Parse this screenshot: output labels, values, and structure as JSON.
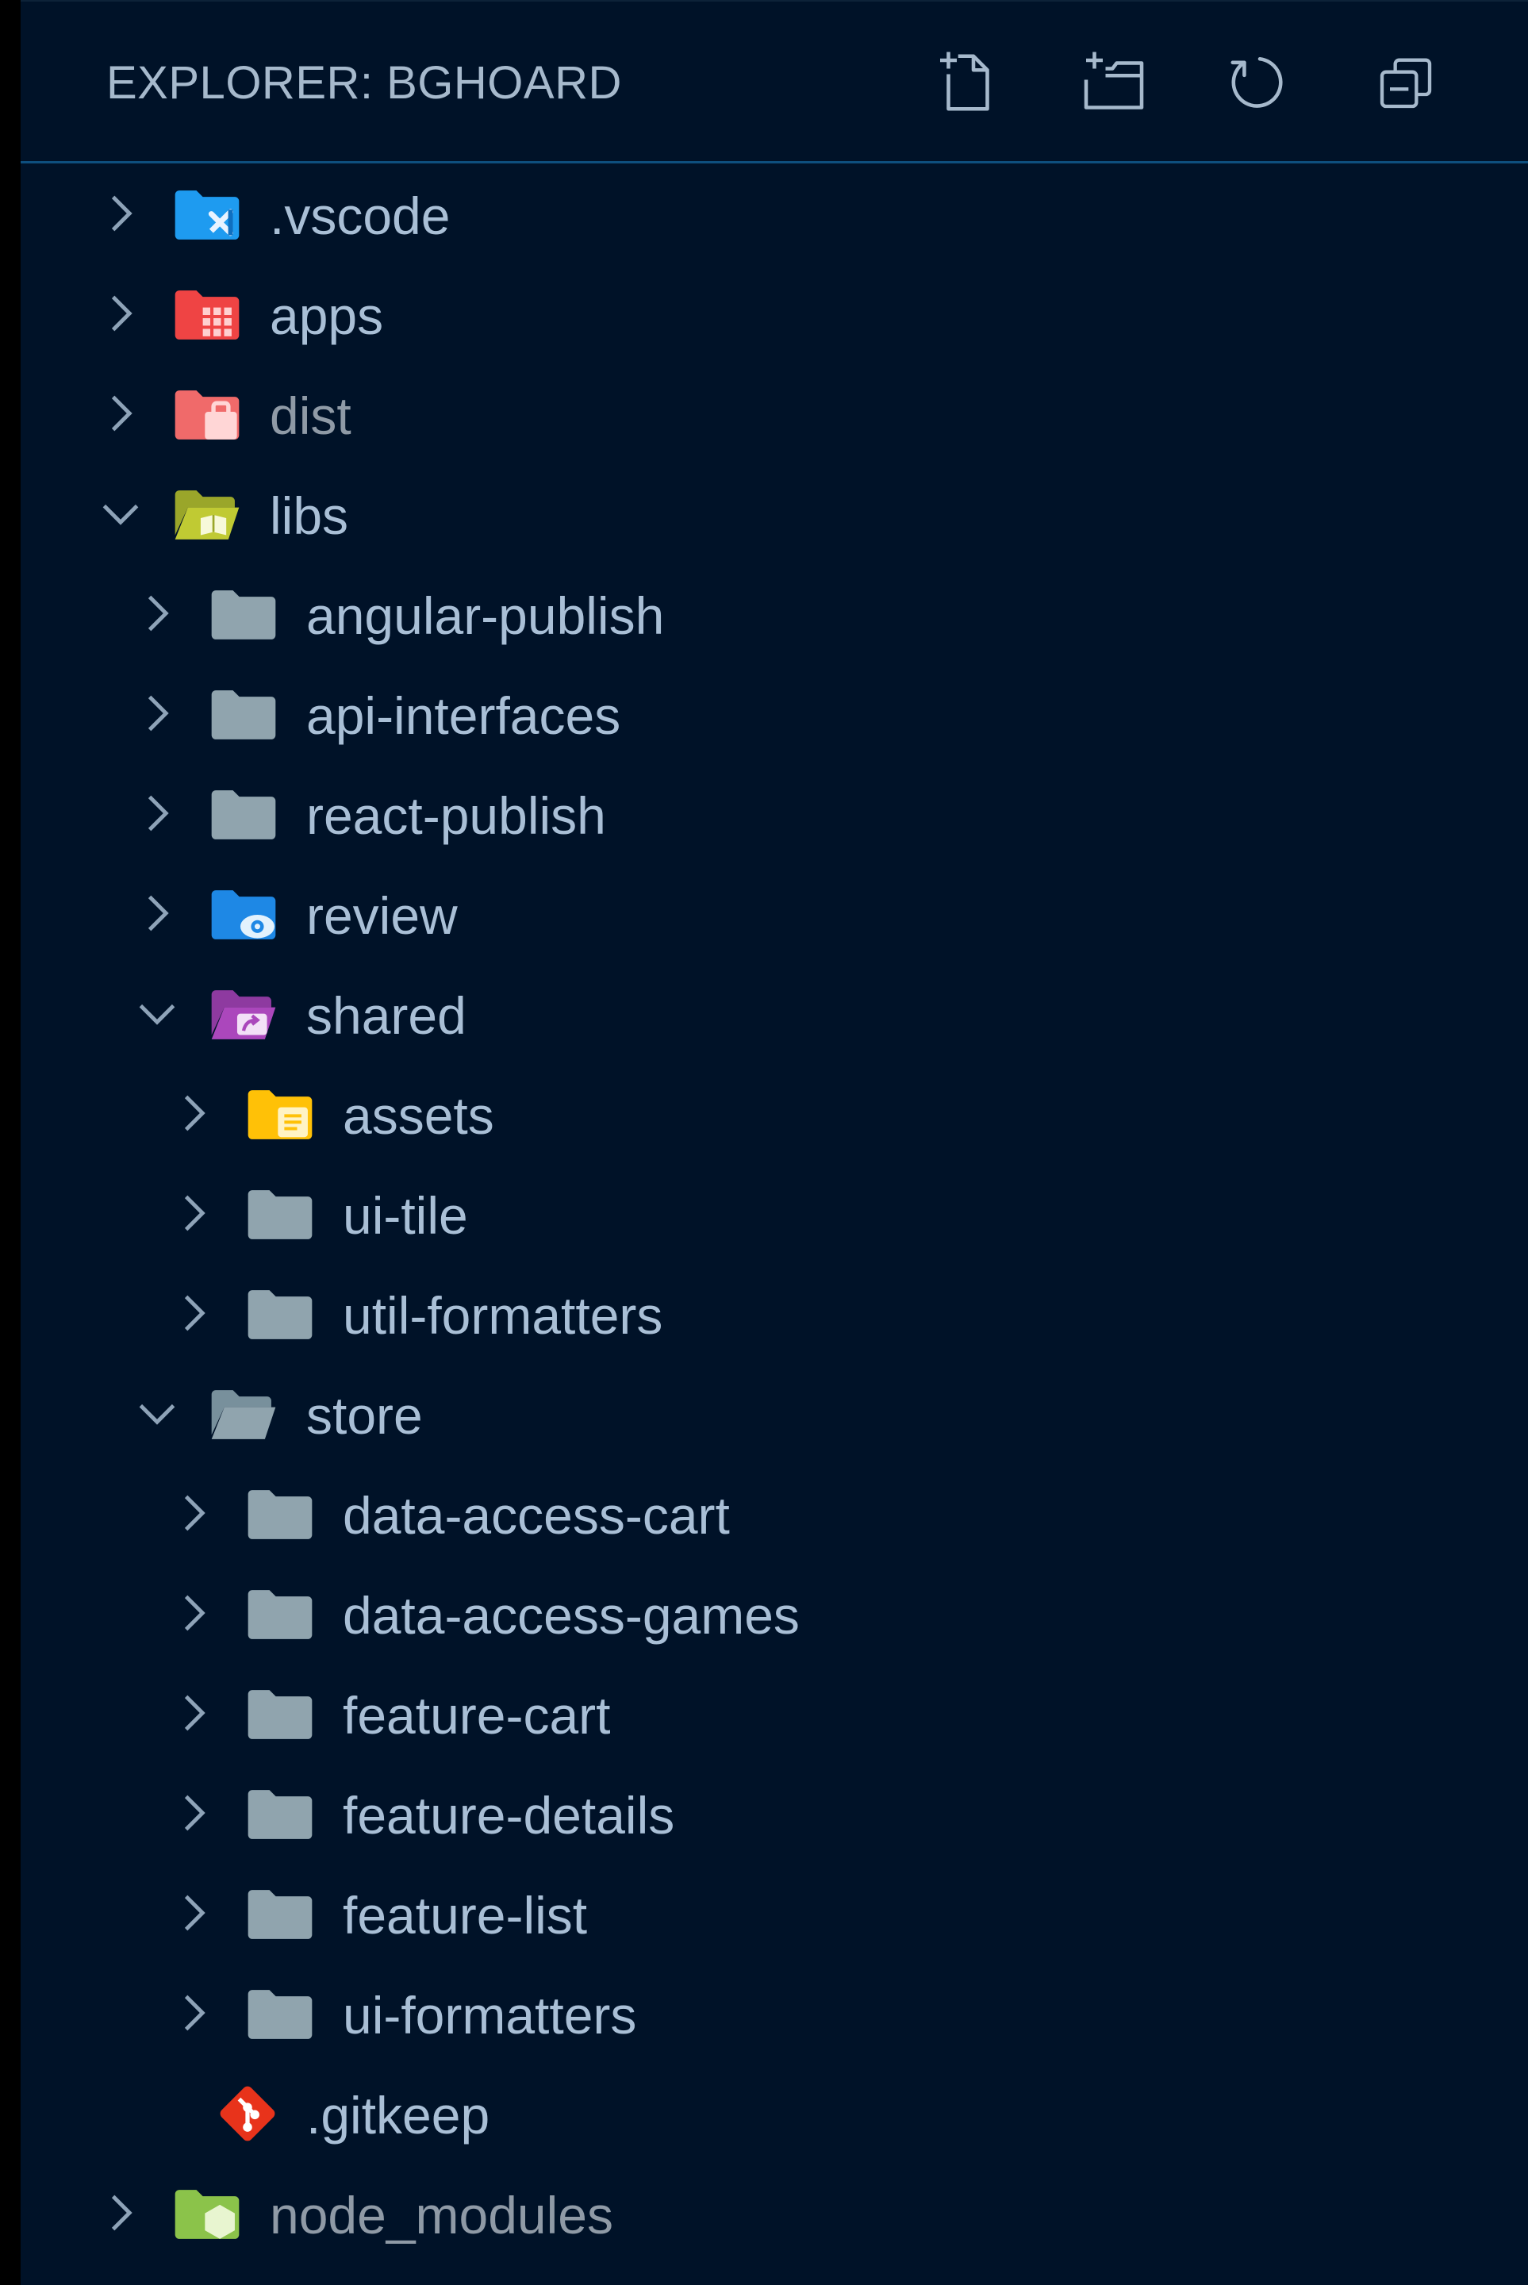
{
  "explorer": {
    "title": "EXPLORER: BGHOARD",
    "actions": [
      {
        "name": "new-file-button",
        "icon": "new-file-icon",
        "tooltip": "New File"
      },
      {
        "name": "new-folder-button",
        "icon": "new-folder-icon",
        "tooltip": "New Folder"
      },
      {
        "name": "refresh-button",
        "icon": "refresh-icon",
        "tooltip": "Refresh Explorer"
      },
      {
        "name": "collapse-all-button",
        "icon": "collapse-all-icon",
        "tooltip": "Collapse Folders in Explorer"
      }
    ]
  },
  "tree": {
    "items": [
      {
        "label": ".vscode",
        "depth": 0,
        "state": "collapsed",
        "icon": "folder-vscode-icon"
      },
      {
        "label": "apps",
        "depth": 0,
        "state": "collapsed",
        "icon": "folder-apps-icon"
      },
      {
        "label": "dist",
        "depth": 0,
        "state": "collapsed",
        "icon": "folder-dist-icon",
        "dimmed": true
      },
      {
        "label": "libs",
        "depth": 0,
        "state": "expanded",
        "icon": "folder-lib-open-icon"
      },
      {
        "label": "angular-publish",
        "depth": 1,
        "state": "collapsed",
        "icon": "folder-icon"
      },
      {
        "label": "api-interfaces",
        "depth": 1,
        "state": "collapsed",
        "icon": "folder-icon"
      },
      {
        "label": "react-publish",
        "depth": 1,
        "state": "collapsed",
        "icon": "folder-icon"
      },
      {
        "label": "review",
        "depth": 1,
        "state": "collapsed",
        "icon": "folder-review-icon"
      },
      {
        "label": "shared",
        "depth": 1,
        "state": "expanded",
        "icon": "folder-shared-open-icon"
      },
      {
        "label": "assets",
        "depth": 2,
        "state": "collapsed",
        "icon": "folder-assets-icon"
      },
      {
        "label": "ui-tile",
        "depth": 2,
        "state": "collapsed",
        "icon": "folder-icon"
      },
      {
        "label": "util-formatters",
        "depth": 2,
        "state": "collapsed",
        "icon": "folder-icon"
      },
      {
        "label": "store",
        "depth": 1,
        "state": "expanded",
        "icon": "folder-open-icon"
      },
      {
        "label": "data-access-cart",
        "depth": 2,
        "state": "collapsed",
        "icon": "folder-icon"
      },
      {
        "label": "data-access-games",
        "depth": 2,
        "state": "collapsed",
        "icon": "folder-icon"
      },
      {
        "label": "feature-cart",
        "depth": 2,
        "state": "collapsed",
        "icon": "folder-icon"
      },
      {
        "label": "feature-details",
        "depth": 2,
        "state": "collapsed",
        "icon": "folder-icon"
      },
      {
        "label": "feature-list",
        "depth": 2,
        "state": "collapsed",
        "icon": "folder-icon"
      },
      {
        "label": "ui-formatters",
        "depth": 2,
        "state": "collapsed",
        "icon": "folder-icon"
      },
      {
        "label": ".gitkeep",
        "depth": 1,
        "state": "file",
        "icon": "git-icon"
      },
      {
        "label": "node_modules",
        "depth": 0,
        "state": "collapsed",
        "icon": "folder-node-icon",
        "dimmed": true
      }
    ]
  },
  "colors": {
    "background": "#001228",
    "header_border": "#0e4f7e",
    "text": "#a9bfd6",
    "text_dimmed": "#8f9aa6",
    "chevron": "#8ea3b8",
    "folder_default": "#90a4ae",
    "folder_vscode": "#1e9bf0",
    "folder_apps": "#ef4444",
    "folder_dist": "#f06a6a",
    "folder_lib": "#c0ca33",
    "folder_review": "#1e88e5",
    "folder_shared": "#ab47bc",
    "folder_assets": "#ffc107",
    "folder_node": "#8bc34a",
    "git": "#e8331b"
  }
}
